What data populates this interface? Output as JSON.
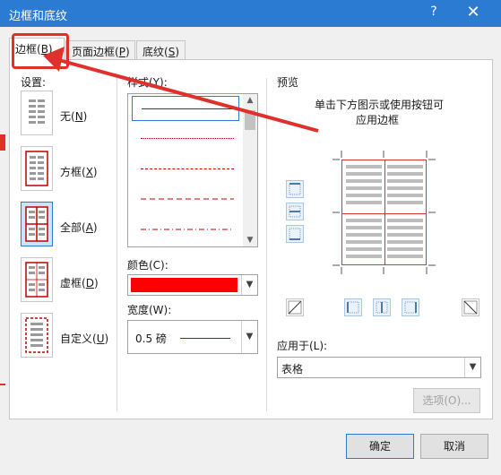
{
  "window": {
    "title": "边框和底纹",
    "help": "?",
    "close": "✕"
  },
  "tabs": [
    {
      "label": "边框(B)",
      "pre": "边框(",
      "key": "B",
      "post": ")"
    },
    {
      "label": "页面边框(P)",
      "pre": "页面边框(",
      "key": "P",
      "post": ")"
    },
    {
      "label": "底纹(S)",
      "pre": "底纹(",
      "key": "S",
      "post": ")"
    }
  ],
  "settings": {
    "heading": "设置:",
    "items": [
      {
        "pre": "无(",
        "key": "N",
        "post": ")"
      },
      {
        "pre": "方框(",
        "key": "X",
        "post": ")"
      },
      {
        "pre": "全部(",
        "key": "A",
        "post": ")"
      },
      {
        "pre": "虚框(",
        "key": "D",
        "post": ")"
      },
      {
        "pre": "自定义(",
        "key": "U",
        "post": ")"
      }
    ],
    "selected": "全部(A)"
  },
  "style": {
    "heading": "样式(Y):",
    "items": [
      "solid",
      "dotted",
      "dashed-fine",
      "dashed",
      "dash-dot"
    ]
  },
  "color": {
    "heading": "颜色(C):",
    "value": "#ff0000"
  },
  "width": {
    "heading": "宽度(W):",
    "value": "0.5 磅"
  },
  "preview": {
    "heading": "预览",
    "hint_line1": "单击下方图示或使用按钮可",
    "hint_line2": "应用边框"
  },
  "apply_to": {
    "heading": "应用于(L):",
    "value": "表格"
  },
  "buttons": {
    "options": "选项(O)...",
    "ok": "确定",
    "cancel": "取消"
  },
  "icons": {
    "close": "close-icon",
    "help": "help-icon"
  },
  "colors": {
    "titlebar": "#2b7bd2",
    "accent_red": "#e0302b"
  }
}
